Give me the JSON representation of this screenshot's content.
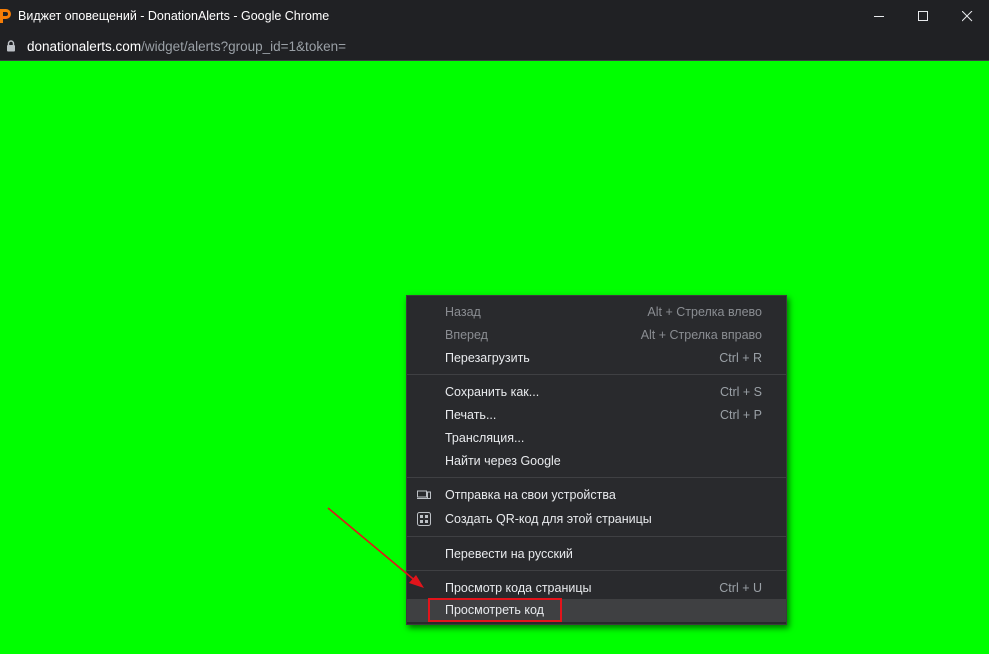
{
  "window": {
    "title": "Виджет оповещений - DonationAlerts - Google Chrome",
    "app_icon": "donationalerts-logo-icon",
    "buttons": [
      "minimize-icon",
      "maximize-icon",
      "close-icon"
    ]
  },
  "address": {
    "host": "donationalerts.com",
    "path": "/widget/alerts?group_id=1&token="
  },
  "page": {
    "background": "#00ff00"
  },
  "context_menu": {
    "items": [
      {
        "label": "Назад",
        "shortcut": "Alt + Стрелка влево",
        "enabled": false
      },
      {
        "label": "Вперед",
        "shortcut": "Alt + Стрелка вправо",
        "enabled": false
      },
      {
        "label": "Перезагрузить",
        "shortcut": "Ctrl + R",
        "enabled": true
      },
      {
        "label": "Сохранить как...",
        "shortcut": "Ctrl + S",
        "enabled": true
      },
      {
        "label": "Печать...",
        "shortcut": "Ctrl + P",
        "enabled": true
      },
      {
        "label": "Трансляция...",
        "shortcut": "",
        "enabled": true
      },
      {
        "label": "Найти через Google",
        "shortcut": "",
        "enabled": true
      },
      {
        "label": "Отправка на свои устройства",
        "shortcut": "",
        "enabled": true,
        "icon": "devices-icon"
      },
      {
        "label": "Создать QR-код для этой страницы",
        "shortcut": "",
        "enabled": true,
        "icon": "qr-code-icon"
      },
      {
        "label": "Перевести на русский",
        "shortcut": "",
        "enabled": true
      },
      {
        "label": "Просмотр кода страницы",
        "shortcut": "Ctrl + U",
        "enabled": true
      },
      {
        "label": "Просмотреть код",
        "shortcut": "",
        "enabled": true,
        "highlighted": true
      }
    ]
  },
  "annotation": {
    "color": "#e2141b"
  }
}
